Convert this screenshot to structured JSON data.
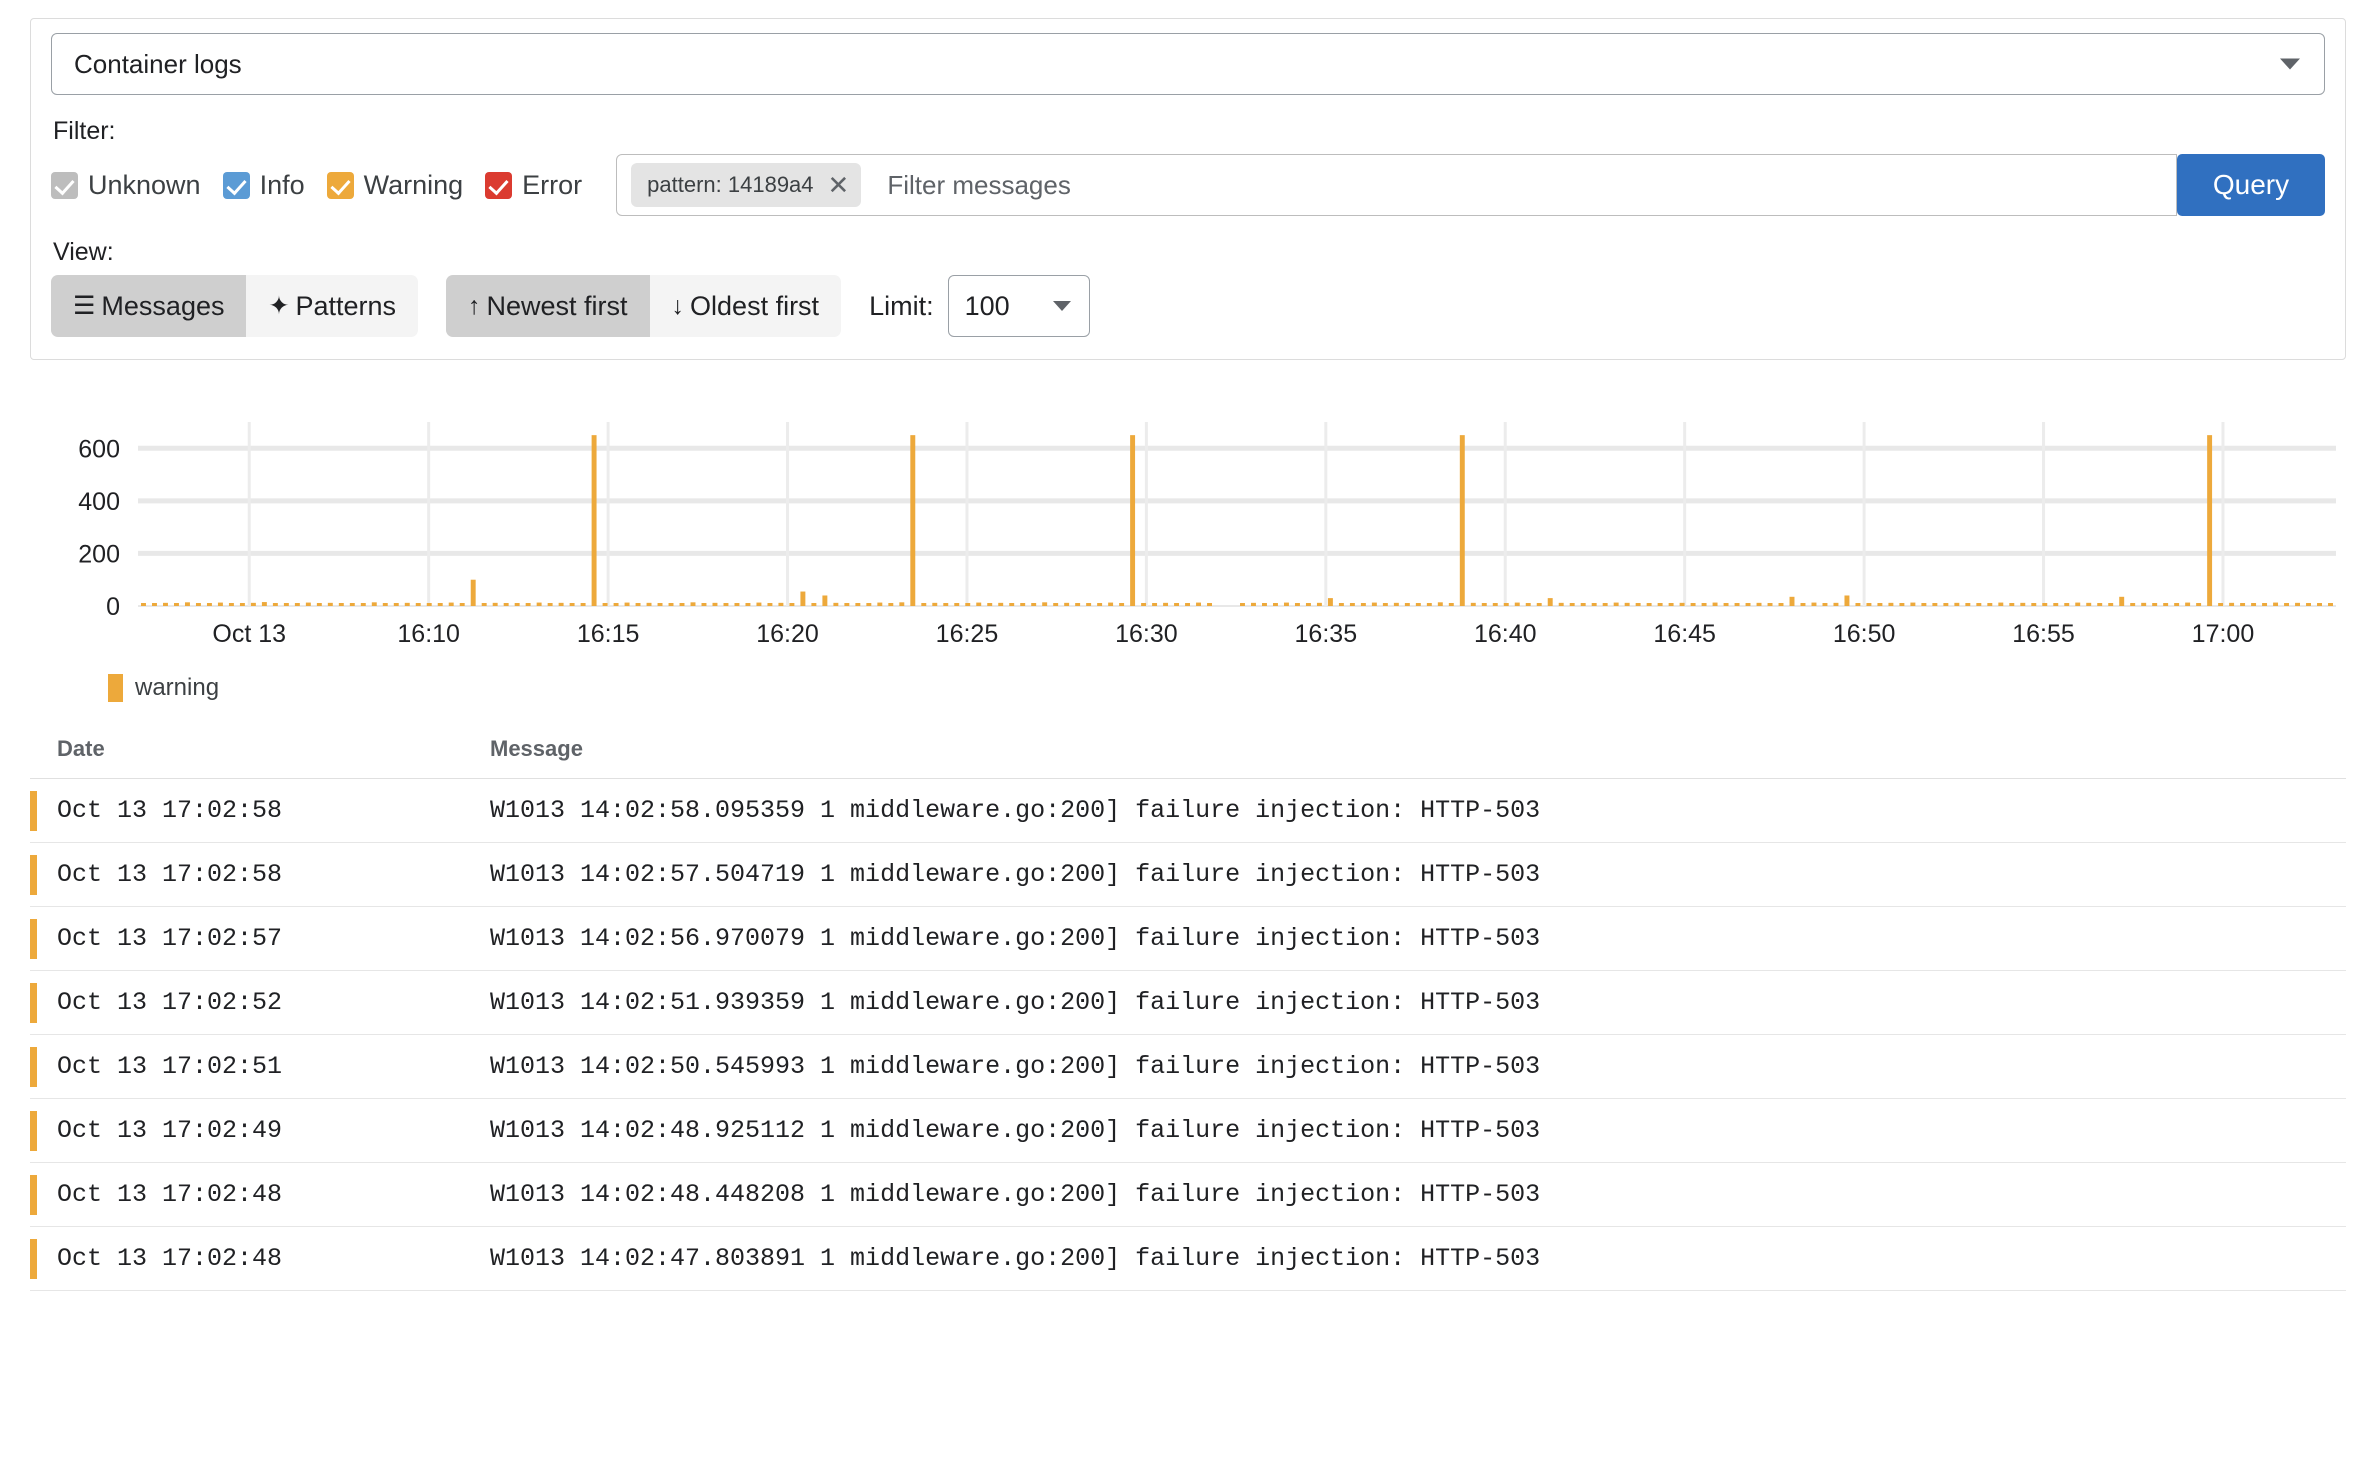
{
  "source_select": {
    "value": "Container logs",
    "caret_icon": "chevron-down-icon"
  },
  "filter": {
    "label": "Filter:",
    "severities": [
      {
        "name": "unknown",
        "label": "Unknown",
        "checked": true,
        "color": "#bdbdbd"
      },
      {
        "name": "info",
        "label": "Info",
        "checked": true,
        "color": "#5b9bd5"
      },
      {
        "name": "warning",
        "label": "Warning",
        "checked": true,
        "color": "#eda93b"
      },
      {
        "name": "error",
        "label": "Error",
        "checked": true,
        "color": "#db3b30"
      }
    ],
    "chip": {
      "text": "pattern: 14189a4",
      "remove_icon": "close-icon"
    },
    "input_placeholder": "Filter messages",
    "input_value": "",
    "query_button": "Query"
  },
  "view": {
    "label": "View:",
    "modes": [
      {
        "name": "messages",
        "label": "Messages",
        "icon": "list-icon",
        "glyph": "☰",
        "active": true
      },
      {
        "name": "patterns",
        "label": "Patterns",
        "icon": "sparkle-icon",
        "glyph": "✦",
        "active": false
      }
    ],
    "sort": [
      {
        "name": "newest",
        "label": "Newest first",
        "icon": "arrow-up-icon",
        "glyph": "↑",
        "active": true
      },
      {
        "name": "oldest",
        "label": "Oldest first",
        "icon": "arrow-down-icon",
        "glyph": "↓",
        "active": false
      }
    ],
    "limit_label": "Limit:",
    "limit_value": "100",
    "limit_caret_icon": "chevron-down-icon"
  },
  "chart_data": {
    "type": "bar",
    "title": "",
    "xlabel": "",
    "ylabel": "",
    "ylim": [
      0,
      700
    ],
    "yticks": [
      0,
      200,
      400,
      600
    ],
    "grid": true,
    "legend_position": "bottom-left",
    "legend": [
      {
        "name": "warning",
        "color": "#eda93b"
      }
    ],
    "xticks": [
      "Oct 13",
      "16:10",
      "16:15",
      "16:20",
      "16:25",
      "16:30",
      "16:35",
      "16:40",
      "16:45",
      "16:50",
      "16:55",
      "17:00"
    ],
    "x_range": [
      "16:05",
      "17:03"
    ],
    "series": [
      {
        "name": "warning",
        "color": "#eda93b",
        "values": [
          8,
          10,
          12,
          9,
          14,
          11,
          8,
          13,
          10,
          9,
          12,
          15,
          11,
          8,
          10,
          13,
          9,
          12,
          10,
          8,
          11,
          14,
          9,
          10,
          12,
          8,
          11,
          9,
          13,
          10,
          100,
          9,
          12,
          8,
          11,
          10,
          13,
          9,
          12,
          10,
          8,
          650,
          11,
          9,
          13,
          10,
          12,
          8,
          11,
          9,
          14,
          10,
          12,
          9,
          11,
          8,
          13,
          10,
          12,
          9,
          55,
          10,
          40,
          12,
          8,
          11,
          9,
          13,
          10,
          14,
          650,
          9,
          12,
          11,
          8,
          10,
          13,
          9,
          12,
          11,
          8,
          10,
          14,
          9,
          12,
          11,
          10,
          8,
          13,
          9,
          650,
          11,
          10,
          12,
          8,
          9,
          13,
          11,
          0,
          0,
          10,
          12,
          9,
          11,
          13,
          10,
          8,
          12,
          30,
          9,
          11,
          10,
          13,
          8,
          12,
          9,
          11,
          10,
          14,
          8,
          650,
          12,
          10,
          9,
          11,
          13,
          8,
          10,
          30,
          12,
          9,
          11,
          10,
          8,
          13,
          12,
          9,
          10,
          11,
          8,
          12,
          10,
          9,
          13,
          11,
          8,
          10,
          12,
          9,
          11,
          35,
          10,
          13,
          8,
          12,
          40,
          9,
          11,
          10,
          12,
          8,
          13,
          9,
          11,
          10,
          12,
          8,
          9,
          11,
          13,
          10,
          12,
          8,
          11,
          9,
          10,
          13,
          12,
          8,
          11,
          35,
          9,
          12,
          10,
          11,
          8,
          13,
          9,
          650,
          10,
          12,
          11,
          8,
          9,
          13,
          10,
          12,
          11,
          8,
          10
        ]
      }
    ]
  },
  "table": {
    "columns": [
      "Date",
      "Message"
    ],
    "rows": [
      {
        "severity_color": "#eda93b",
        "date": "Oct 13 17:02:58",
        "message": "W1013 14:02:58.095359 1 middleware.go:200] failure injection: HTTP-503"
      },
      {
        "severity_color": "#eda93b",
        "date": "Oct 13 17:02:58",
        "message": "W1013 14:02:57.504719 1 middleware.go:200] failure injection: HTTP-503"
      },
      {
        "severity_color": "#eda93b",
        "date": "Oct 13 17:02:57",
        "message": "W1013 14:02:56.970079 1 middleware.go:200] failure injection: HTTP-503"
      },
      {
        "severity_color": "#eda93b",
        "date": "Oct 13 17:02:52",
        "message": "W1013 14:02:51.939359 1 middleware.go:200] failure injection: HTTP-503"
      },
      {
        "severity_color": "#eda93b",
        "date": "Oct 13 17:02:51",
        "message": "W1013 14:02:50.545993 1 middleware.go:200] failure injection: HTTP-503"
      },
      {
        "severity_color": "#eda93b",
        "date": "Oct 13 17:02:49",
        "message": "W1013 14:02:48.925112 1 middleware.go:200] failure injection: HTTP-503"
      },
      {
        "severity_color": "#eda93b",
        "date": "Oct 13 17:02:48",
        "message": "W1013 14:02:48.448208 1 middleware.go:200] failure injection: HTTP-503"
      },
      {
        "severity_color": "#eda93b",
        "date": "Oct 13 17:02:48",
        "message": "W1013 14:02:47.803891 1 middleware.go:200] failure injection: HTTP-503"
      }
    ]
  }
}
